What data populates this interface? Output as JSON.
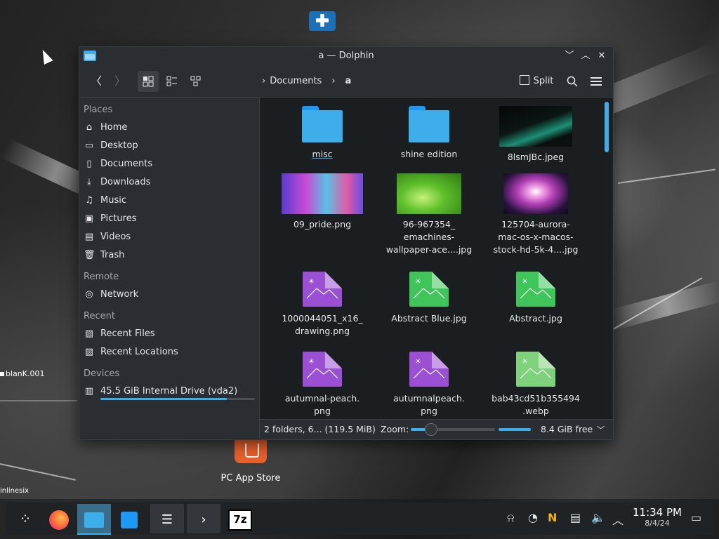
{
  "desktop": {
    "app_store_label": "PC App Store",
    "blank_label": "blanK.001",
    "inline_label": "inlinesix"
  },
  "window": {
    "title": "a — Dolphin",
    "controls": {
      "minimize": "﹀",
      "maximize": "︿",
      "close": "✕"
    }
  },
  "toolbar": {
    "back_icon": "〈",
    "forward_icon": "〉",
    "view_icons": "icons-view-icon",
    "view_compact": "compact-view-icon",
    "view_details": "details-view-icon",
    "breadcrumb": [
      "Documents",
      "a"
    ],
    "split_label": "Split"
  },
  "sidebar": {
    "places_header": "Places",
    "places": [
      {
        "label": "Home",
        "icon": "home-icon"
      },
      {
        "label": "Desktop",
        "icon": "desktop-icon"
      },
      {
        "label": "Documents",
        "icon": "documents-icon"
      },
      {
        "label": "Downloads",
        "icon": "downloads-icon"
      },
      {
        "label": "Music",
        "icon": "music-icon"
      },
      {
        "label": "Pictures",
        "icon": "pictures-icon"
      },
      {
        "label": "Videos",
        "icon": "videos-icon"
      },
      {
        "label": "Trash",
        "icon": "trash-icon"
      }
    ],
    "remote_header": "Remote",
    "remote": [
      {
        "label": "Network",
        "icon": "network-icon"
      }
    ],
    "recent_header": "Recent",
    "recent": [
      {
        "label": "Recent Files",
        "icon": "recent-files-icon"
      },
      {
        "label": "Recent Locations",
        "icon": "recent-locations-icon"
      }
    ],
    "devices_header": "Devices",
    "devices": [
      {
        "label": "45.5 GiB Internal Drive (vda2)",
        "icon": "drive-icon",
        "usage": 0.82
      }
    ]
  },
  "files": [
    {
      "name": "misc",
      "type": "folder"
    },
    {
      "name": "shine edition",
      "type": "folder"
    },
    {
      "name": "8lsmJBc.jpeg",
      "type": "photo"
    },
    {
      "name": "09_pride.png",
      "type": "photo"
    },
    {
      "name": "96-967354_\nemachines-\nwallpaper-ace....jpg",
      "type": "photo"
    },
    {
      "name": "125704-aurora-\nmac-os-x-macos-\nstock-hd-5k-4....jpg",
      "type": "photo"
    },
    {
      "name": "1000044051_x16_\ndrawing.png",
      "type": "image-png"
    },
    {
      "name": "Abstract Blue.jpg",
      "type": "image-jpg"
    },
    {
      "name": "Abstract.jpg",
      "type": "image-jpg"
    },
    {
      "name": "autumnal-peach.\npng",
      "type": "image-png"
    },
    {
      "name": "autumnalpeach.\npng",
      "type": "image-png"
    },
    {
      "name": "bab43cd51b355494\n.webp",
      "type": "image-webp"
    }
  ],
  "statusbar": {
    "summary": "2 folders, 6... (119.5 MiB)",
    "zoom_label": "Zoom:",
    "free_space": "8.4 GiB free"
  },
  "taskbar": {
    "clock_time": "11:34 PM",
    "clock_date": "8/4/24",
    "items": [
      "app-launcher-icon",
      "firefox-icon",
      "dolphin-icon",
      "discover-icon",
      "settings-icon",
      "konsole-icon",
      "7zip-icon"
    ],
    "tray": [
      "notifications-icon",
      "updates-icon",
      "app-icon",
      "clipboard-icon",
      "volume-icon",
      "expand-tray-icon",
      "show-desktop-icon"
    ]
  },
  "colors": {
    "accent": "#3daee9",
    "window_bg": "#202326",
    "sidebar_bg": "#2a2e32",
    "content_bg": "#1b1e20",
    "png_icon": "#9b4fd3",
    "jpg_icon": "#3fc55a",
    "webp_icon": "#7fd27c"
  }
}
